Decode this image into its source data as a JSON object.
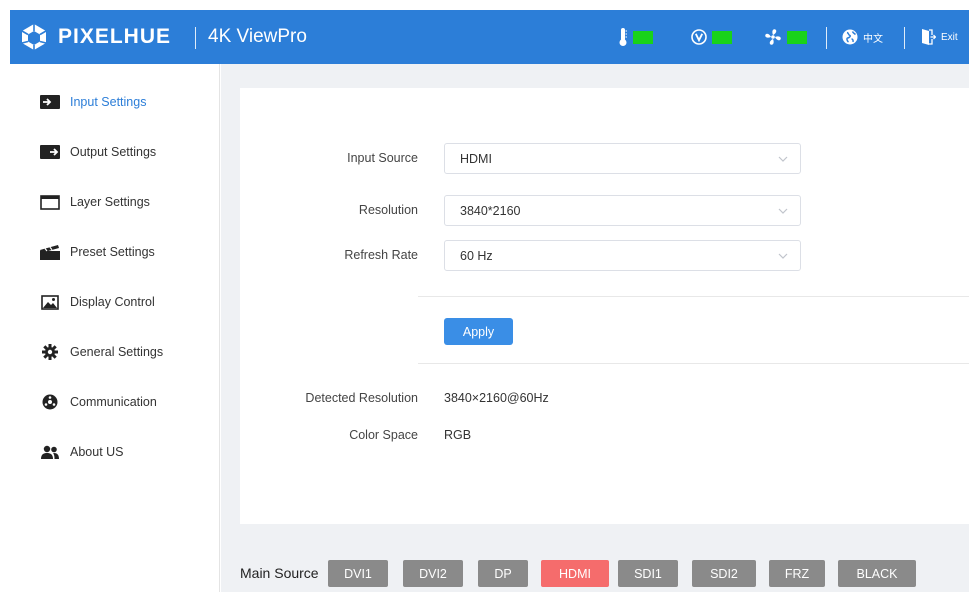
{
  "header": {
    "brand": "PIXELHUE",
    "product": "4K ViewPro",
    "language": "中文",
    "exit": "Exit",
    "status_icons": [
      "thermometer-icon",
      "voltage-icon",
      "fan-icon"
    ],
    "status_color": "#19d219",
    "accent_color": "#2c7ed8"
  },
  "sidebar": {
    "items": [
      {
        "label": "Input Settings",
        "icon": "input-icon",
        "active": true
      },
      {
        "label": "Output Settings",
        "icon": "output-icon",
        "active": false
      },
      {
        "label": "Layer Settings",
        "icon": "layer-icon",
        "active": false
      },
      {
        "label": "Preset Settings",
        "icon": "preset-icon",
        "active": false
      },
      {
        "label": "Display Control",
        "icon": "image-icon",
        "active": false
      },
      {
        "label": "General Settings",
        "icon": "gear-icon",
        "active": false
      },
      {
        "label": "Communication",
        "icon": "communication-icon",
        "active": false
      },
      {
        "label": "About US",
        "icon": "users-icon",
        "active": false
      }
    ]
  },
  "form": {
    "input_source": {
      "label": "Input Source",
      "value": "HDMI"
    },
    "resolution": {
      "label": "Resolution",
      "value": "3840*2160"
    },
    "refresh_rate": {
      "label": "Refresh Rate",
      "value": "60 Hz"
    },
    "apply_label": "Apply"
  },
  "info": {
    "detected_resolution": {
      "label": "Detected Resolution",
      "value": "3840×2160@60Hz"
    },
    "color_space": {
      "label": "Color Space",
      "value": "RGB"
    }
  },
  "main_source": {
    "label": "Main Source",
    "buttons": [
      "DVI1",
      "DVI2",
      "DP",
      "HDMI",
      "SDI1",
      "SDI2",
      "FRZ",
      "BLACK"
    ],
    "active": "HDMI",
    "active_color": "#f56c6c"
  }
}
